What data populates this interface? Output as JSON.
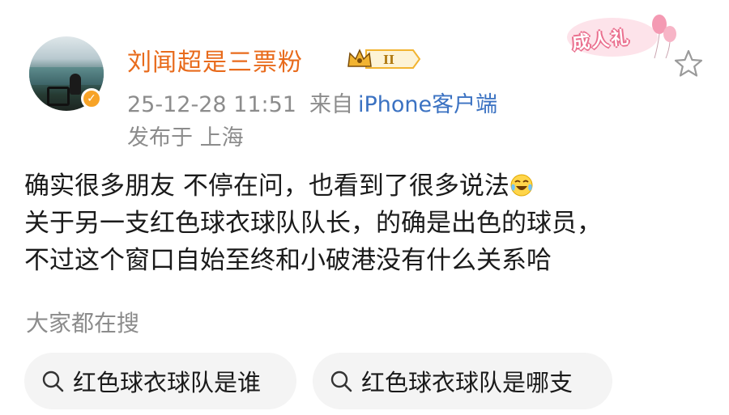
{
  "post": {
    "author": {
      "name": "刘闻超是三票粉",
      "fan_level": "II",
      "verified": true
    },
    "timestamp": "25-12-28 11:51",
    "source_prefix": "来自",
    "source_client": "iPhone客户端",
    "location": "发布于 上海",
    "badge_text": "成人礼",
    "content_lines": [
      "确实很多朋友 不停在问，也看到了很多说法",
      "关于另一支红色球衣球队队长，的确是出色的球员，",
      "不过这个窗口自始至终和小破港没有什么关系哈"
    ]
  },
  "search": {
    "heading": "大家都在搜",
    "chips": [
      {
        "label": "红色球衣球队是谁"
      },
      {
        "label": "红色球衣球队是哪支"
      }
    ]
  },
  "colors": {
    "username": "#e86b1c",
    "link": "#3b72c2",
    "meta": "#8c8c8c",
    "chip_bg": "#f4f4f4",
    "verified": "#f7a327",
    "fan_badge": "#f2b431"
  },
  "icons": {
    "verified": "verified-v-icon",
    "fan_badge": "crown-icon",
    "favorite": "star-icon",
    "emoji": "crying-laughing-emoji",
    "search": "search-icon"
  }
}
